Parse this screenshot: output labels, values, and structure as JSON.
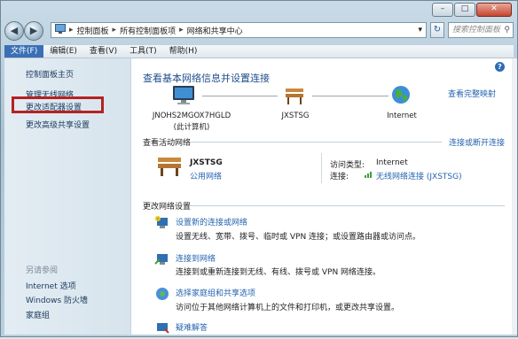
{
  "window": {
    "minimize": "–",
    "maximize": "□",
    "close": "✕"
  },
  "nav": {
    "back": "◀",
    "forward": "▶",
    "breadcrumbs": [
      "控制面板",
      "所有控制面板项",
      "网络和共享中心"
    ],
    "refresh": "↻",
    "search_placeholder": "搜索控制面板"
  },
  "menu": [
    "文件(F)",
    "编辑(E)",
    "查看(V)",
    "工具(T)",
    "帮助(H)"
  ],
  "sidebar": {
    "items": [
      "控制面板主页",
      "管理无线网络",
      "更改适配器设置",
      "更改高级共享设置"
    ],
    "see_also_title": "另请参阅",
    "see_also": [
      "Internet 选项",
      "Windows 防火墙",
      "家庭组"
    ]
  },
  "main": {
    "title": "查看基本网络信息并设置连接",
    "full_map_link": "查看完整映射",
    "nodes": [
      {
        "name": "JNOHS2MGOX7HGLD",
        "sub": "(此计算机)"
      },
      {
        "name": "JXSTSG",
        "sub": ""
      },
      {
        "name": "Internet",
        "sub": ""
      }
    ],
    "active_label": "查看活动网络",
    "connect_link": "连接或断开连接",
    "network": {
      "name": "JXSTSG",
      "type": "公用网络",
      "access_label": "访问类型:",
      "access_value": "Internet",
      "conn_label": "连接:",
      "conn_value": "无线网络连接 (JXSTSG)"
    },
    "change_label": "更改网络设置",
    "tasks": [
      {
        "title": "设置新的连接或网络",
        "desc": "设置无线、宽带、拨号、临时或 VPN 连接；或设置路由器或访问点。"
      },
      {
        "title": "连接到网络",
        "desc": "连接到或重新连接到无线、有线、拨号或 VPN 网络连接。"
      },
      {
        "title": "选择家庭组和共享选项",
        "desc": "访问位于其他网络计算机上的文件和打印机，或更改共享设置。"
      },
      {
        "title": "疑难解答",
        "desc": ""
      }
    ]
  },
  "colors": {
    "highlight": "#b52222",
    "link": "#2664b0",
    "menu_active": "#3a6fb5"
  }
}
